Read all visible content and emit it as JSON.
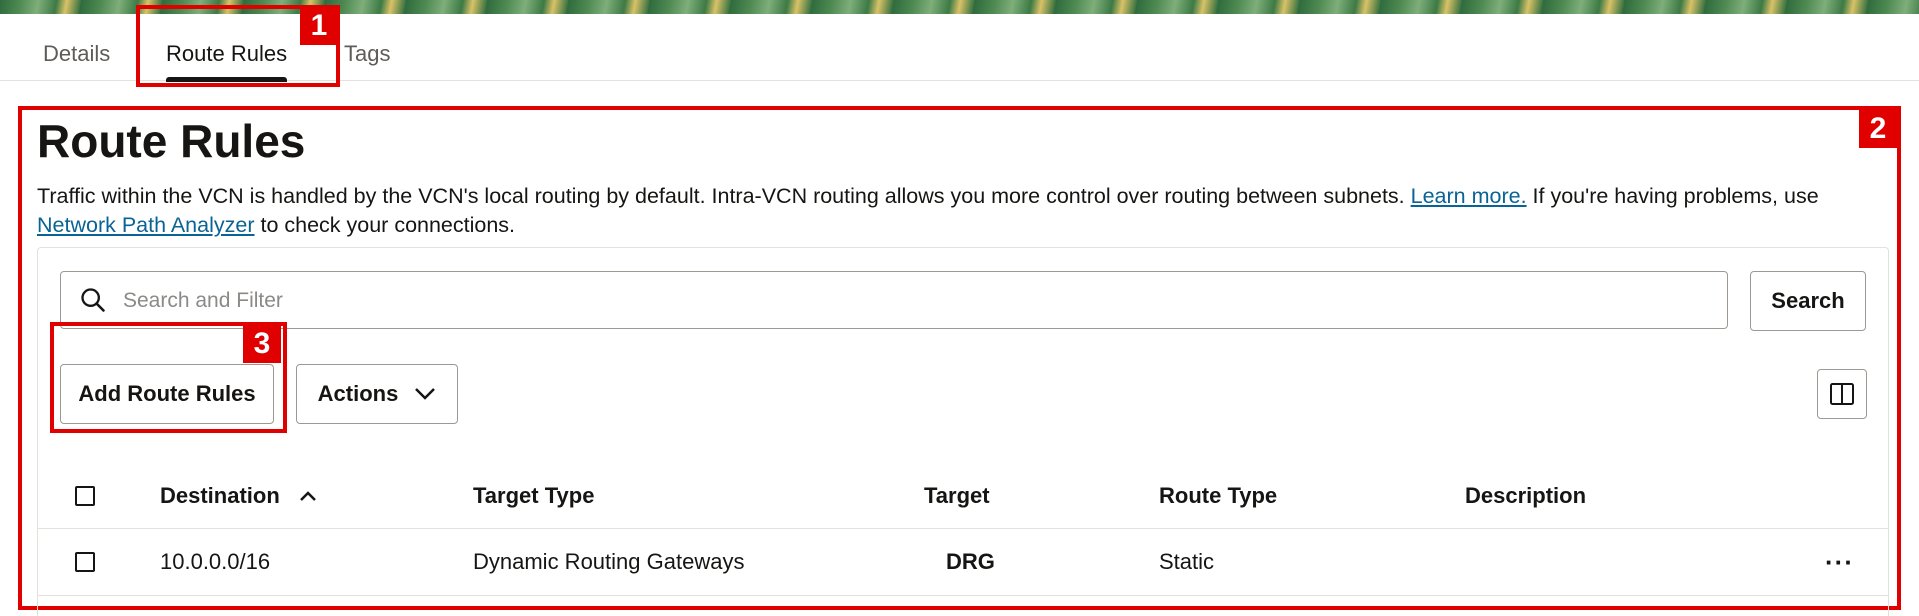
{
  "tabs": [
    {
      "label": "Details",
      "active": false
    },
    {
      "label": "Route Rules",
      "active": true
    },
    {
      "label": "Tags",
      "active": false
    }
  ],
  "callouts": [
    "1",
    "2",
    "3"
  ],
  "section": {
    "title": "Route Rules",
    "description_part1": "Traffic within the VCN is handled by the VCN's local routing by default. Intra-VCN routing allows you more control over routing between subnets. ",
    "learn_more_link": "Learn more.",
    "description_part2": " If you're having problems, use ",
    "network_path_link": "Network Path Analyzer",
    "description_part3": " to check your connections."
  },
  "search": {
    "placeholder": "Search and Filter",
    "value": "",
    "button_label": "Search"
  },
  "toolbar": {
    "add_label": "Add Route Rules",
    "actions_label": "Actions"
  },
  "table": {
    "columns": [
      "Destination",
      "Target Type",
      "Target",
      "Route Type",
      "Description"
    ],
    "sort": {
      "column": "Destination",
      "direction": "ascending"
    },
    "rows": [
      {
        "destination": "10.0.0.0/16",
        "target_type": "Dynamic Routing Gateways",
        "target": "DRG",
        "route_type": "Static",
        "description": ""
      }
    ]
  },
  "colors": {
    "callout": "#e00000",
    "link": "#0a6396",
    "text": "#161513"
  }
}
